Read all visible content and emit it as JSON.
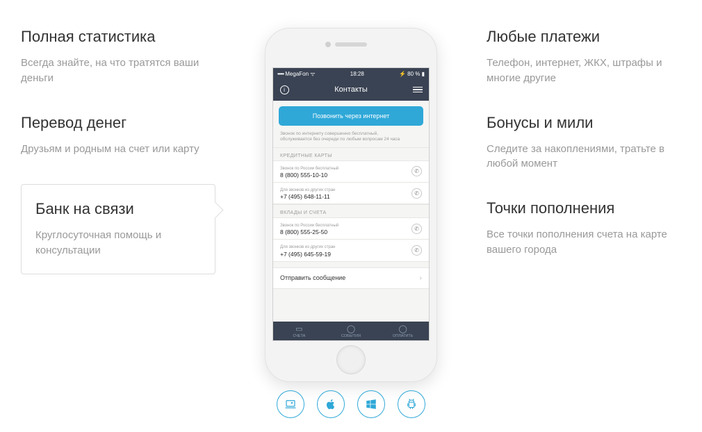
{
  "left_features": [
    {
      "title": "Полная статистика",
      "desc": "Всегда знайте, на что тратятся ваши деньги",
      "active": false
    },
    {
      "title": "Перевод денег",
      "desc": "Друзьям и родным на счет или карту",
      "active": false
    },
    {
      "title": "Банк на связи",
      "desc": "Круглосуточная помощь и консультации",
      "active": true
    }
  ],
  "right_features": [
    {
      "title": "Любые платежи",
      "desc": "Телефон, интернет, ЖКХ, штрафы и многие другие"
    },
    {
      "title": "Бонусы и мили",
      "desc": "Следите за накоплениями, тратьте в любой момент"
    },
    {
      "title": "Точки пополнения",
      "desc": "Все точки пополнения счета на карте вашего города"
    }
  ],
  "phone": {
    "status": {
      "carrier": "MegaFon",
      "signal": "•••••",
      "time": "18:28",
      "battery": "80 %"
    },
    "nav_title": "Контакты",
    "call_button": "Позвонить через интернет",
    "note_line1": "Звонок по интернету совершенно бесплатный,",
    "note_line2": "обслуживается без очереди по любым вопросам 24 часа",
    "sections": [
      {
        "header": "КРЕДИТНЫЕ КАРТЫ",
        "rows": [
          {
            "sub": "Звонок по России бесплатный",
            "num": "8 (800) 555-10-10"
          },
          {
            "sub": "Для звонков из других стран",
            "num": "+7 (495) 648-11-11"
          }
        ]
      },
      {
        "header": "ВКЛАДЫ И СЧЕТА",
        "rows": [
          {
            "sub": "Звонок по России бесплатный",
            "num": "8 (800) 555-25-50"
          },
          {
            "sub": "Для звонков из других стран",
            "num": "+7 (495) 645-59-19"
          }
        ]
      }
    ],
    "send_message": "Отправить сообщение",
    "tabs": [
      {
        "label": "СЧЕТА"
      },
      {
        "label": "СОБЫТИЯ"
      },
      {
        "label": "ОПЛАТИТЬ"
      }
    ]
  },
  "platforms": [
    "laptop",
    "apple",
    "windows",
    "android"
  ]
}
